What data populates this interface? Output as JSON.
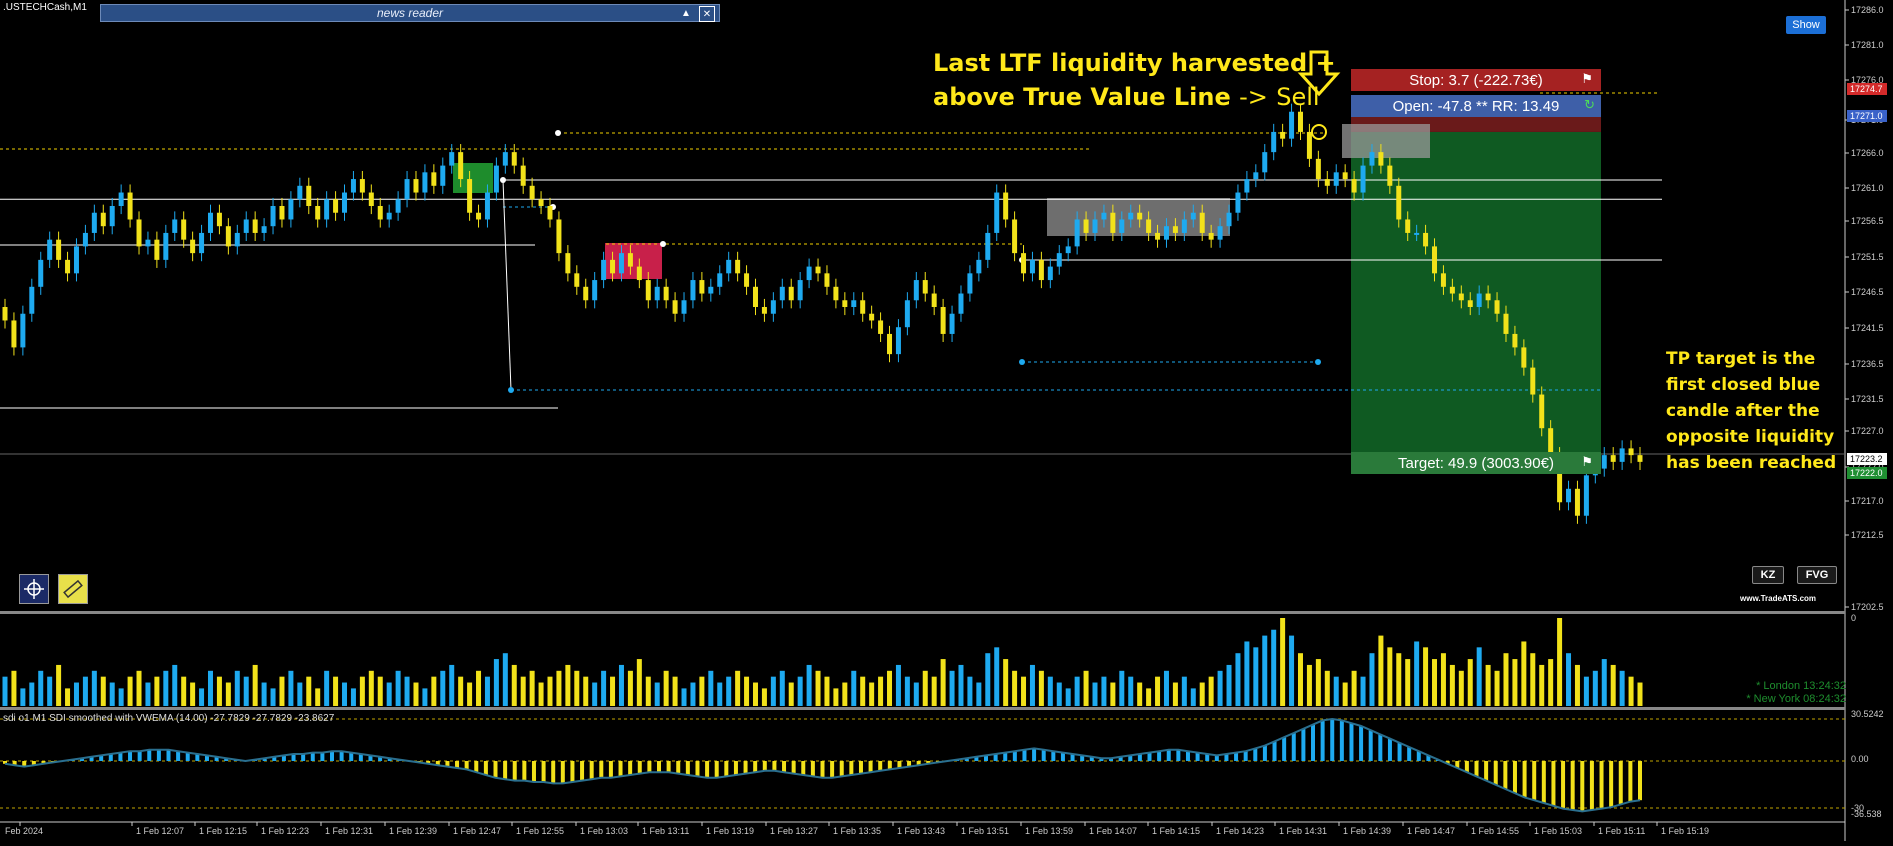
{
  "window": {
    "symbol_title": ".USTECHCash,M1"
  },
  "news_reader": {
    "title": "news reader",
    "collapse_icon": "triangle-up-icon",
    "close_icon": "close-x-icon"
  },
  "show_button": {
    "label": "Show"
  },
  "tool_buttons": {
    "crosshair_icon": "crosshair-icon",
    "ruler_icon": "ruler-icon"
  },
  "indicator_buttons": {
    "kz": "KZ",
    "fvg": "FVG"
  },
  "watermark": "www.TradeATS.com",
  "annotations": {
    "main_line1": "Last LTF liquidity harvested +",
    "main_line2": "above True Value Line",
    "main_arrow": "->",
    "main_sell": "Sell",
    "tp_note": "TP target is the first closed blue candle after the opposite liquidity has been reached"
  },
  "trade": {
    "stop_label": "Stop: 3.7 (-222.73€)",
    "open_label": "Open: -47.8 ** RR: 13.49",
    "target_label": "Target: 49.9 (3003.90€)"
  },
  "price_scale": {
    "labels": [
      "17286.0",
      "17281.0",
      "17276.0",
      "17271.0",
      "17266.0",
      "17261.0",
      "17256.5",
      "17251.5",
      "17246.5",
      "17241.5",
      "17236.5",
      "17231.5",
      "17227.0",
      "17222.0",
      "17217.0",
      "17212.5",
      "17202.5"
    ],
    "tags": [
      {
        "text": "17274.7",
        "color": "#d42a2a"
      },
      {
        "text": "17271.0",
        "color": "#3a62c9"
      },
      {
        "text": "17223.2",
        "color": "#ffffff"
      },
      {
        "text": "17222.0",
        "color": "#1f8f32"
      }
    ]
  },
  "time_axis": {
    "labels": [
      "Feb 2024",
      "1 Feb 12:07",
      "1 Feb 12:15",
      "1 Feb 12:23",
      "1 Feb 12:31",
      "1 Feb 12:39",
      "1 Feb 12:47",
      "1 Feb 12:55",
      "1 Feb 13:03",
      "1 Feb 13:11",
      "1 Feb 13:19",
      "1 Feb 13:27",
      "1 Feb 13:35",
      "1 Feb 13:43",
      "1 Feb 13:51",
      "1 Feb 13:59",
      "1 Feb 14:07",
      "1 Feb 14:15",
      "1 Feb 14:23",
      "1 Feb 14:31",
      "1 Feb 14:39",
      "1 Feb 14:47",
      "1 Feb 14:55",
      "1 Feb 15:03",
      "1 Feb 15:11",
      "1 Feb 15:19"
    ]
  },
  "volume_panel": {
    "scale_top": "0"
  },
  "sessions": {
    "london": "* London   13:24:32",
    "new_york": "* New York   08:24:32"
  },
  "sdi_panel": {
    "label": "sdi o1 M1 SDI smoothed with VWEMA (14.00) -27.7829 -27.7829 -23.8627",
    "scale": [
      "30.5242",
      "0.00",
      "-30",
      "-36.538"
    ]
  },
  "chart_data": {
    "type": "candlestick",
    "symbol": ".USTECHCash",
    "timeframe": "M1",
    "ylim": [
      17200,
      17290
    ],
    "colors": {
      "bull": "#1eaaf0",
      "bear": "#f2e21a"
    },
    "candles_close": [
      17243,
      17239,
      17244,
      17248,
      17252,
      17255,
      17252,
      17250,
      17254,
      17256,
      17259,
      17257,
      17260,
      17262,
      17258,
      17254,
      17255,
      17252,
      17256,
      17258,
      17255,
      17253,
      17256,
      17259,
      17257,
      17254,
      17256,
      17258,
      17256,
      17257,
      17260,
      17258,
      17261,
      17263,
      17260,
      17258,
      17261,
      17259,
      17262,
      17264,
      17262,
      17260,
      17258,
      17259,
      17261,
      17264,
      17262,
      17265,
      17263,
      17266,
      17268,
      17264,
      17259,
      17258,
      17262,
      17266,
      17268,
      17266,
      17263,
      17261,
      17260,
      17258,
      17253,
      17250,
      17248,
      17246,
      17249,
      17252,
      17250,
      17253,
      17251,
      17249,
      17246,
      17248,
      17246,
      17244,
      17246,
      17249,
      17247,
      17248,
      17250,
      17252,
      17250,
      17248,
      17245,
      17244,
      17246,
      17248,
      17246,
      17249,
      17251,
      17250,
      17248,
      17246,
      17245,
      17246,
      17244,
      17243,
      17241,
      17238,
      17242,
      17246,
      17249,
      17247,
      17245,
      17241,
      17244,
      17247,
      17250,
      17252,
      17256,
      17262,
      17258,
      17253,
      17250,
      17252,
      17249,
      17251,
      17253,
      17254,
      17258,
      17256,
      17258,
      17259,
      17256,
      17258,
      17259,
      17258,
      17256,
      17255,
      17257,
      17256,
      17258,
      17259,
      17256,
      17255,
      17257,
      17259,
      17262,
      17264,
      17265,
      17268,
      17271,
      17270,
      17274,
      17271,
      17267,
      17264,
      17263,
      17265,
      17264,
      17262,
      17266,
      17268,
      17266,
      17263,
      17258,
      17256,
      17256,
      17254,
      17250,
      17248,
      17247,
      17246,
      17245,
      17247,
      17246,
      17244,
      17241,
      17239,
      17236,
      17232,
      17227,
      17223,
      17216,
      17218,
      17214,
      17220,
      17221,
      17223,
      17222,
      17224,
      17223,
      17222
    ],
    "current_price": 17223.2,
    "levels": {
      "stop": 17274.7,
      "entry": 17271.0,
      "target": 17222.0,
      "true_value_line": 17261.0,
      "level_17251": 17251.5,
      "level_17254": 17254.0,
      "level_17230": 17230.5,
      "liquidity_17268": 17268.0,
      "liquidity_17254": 17254.0,
      "liquidity_17236": 17236.5,
      "liquidity_17231": 17231.5
    },
    "volume": [
      5,
      6,
      3,
      4,
      6,
      5,
      7,
      3,
      4,
      5,
      6,
      5,
      4,
      3,
      5,
      6,
      4,
      5,
      6,
      7,
      5,
      4,
      3,
      6,
      5,
      4,
      6,
      5,
      7,
      4,
      3,
      5,
      6,
      4,
      5,
      3,
      6,
      5,
      4,
      3,
      5,
      6,
      5,
      4,
      6,
      5,
      4,
      3,
      5,
      6,
      7,
      5,
      4,
      6,
      5,
      8,
      9,
      7,
      5,
      6,
      4,
      5,
      6,
      7,
      6,
      5,
      4,
      6,
      5,
      7,
      6,
      8,
      5,
      4,
      6,
      5,
      3,
      4,
      5,
      6,
      4,
      5,
      6,
      5,
      4,
      3,
      5,
      6,
      4,
      5,
      7,
      6,
      5,
      3,
      4,
      6,
      5,
      4,
      5,
      6,
      7,
      5,
      4,
      6,
      5,
      8,
      6,
      7,
      5,
      4,
      9,
      10,
      8,
      6,
      5,
      7,
      6,
      5,
      4,
      3,
      5,
      6,
      4,
      5,
      4,
      6,
      5,
      4,
      3,
      5,
      6,
      4,
      5,
      3,
      4,
      5,
      6,
      7,
      9,
      11,
      10,
      12,
      13,
      15,
      12,
      9,
      7,
      8,
      6,
      5,
      4,
      6,
      5,
      9,
      12,
      10,
      9,
      8,
      11,
      10,
      8,
      9,
      7,
      6,
      8,
      10,
      7,
      6,
      9,
      8,
      11,
      9,
      7,
      8,
      15,
      9,
      7,
      5,
      6,
      8,
      7,
      6,
      5,
      4
    ],
    "sdi": [
      -2,
      -3,
      -4,
      -3,
      -2,
      -1,
      0,
      1,
      2,
      3,
      4,
      5,
      6,
      7,
      7,
      8,
      8,
      8,
      7,
      6,
      5,
      4,
      3,
      2,
      1,
      0,
      1,
      2,
      3,
      4,
      5,
      5,
      6,
      6,
      7,
      7,
      6,
      5,
      4,
      3,
      2,
      1,
      0,
      -1,
      -2,
      -3,
      -4,
      -5,
      -6,
      -8,
      -10,
      -12,
      -13,
      -14,
      -14,
      -15,
      -15,
      -16,
      -16,
      -15,
      -14,
      -13,
      -12,
      -12,
      -11,
      -10,
      -9,
      -8,
      -8,
      -8,
      -9,
      -10,
      -11,
      -12,
      -12,
      -11,
      -10,
      -9,
      -8,
      -7,
      -7,
      -8,
      -9,
      -10,
      -11,
      -12,
      -12,
      -11,
      -10,
      -9,
      -8,
      -7,
      -6,
      -5,
      -4,
      -3,
      -2,
      -1,
      0,
      1,
      2,
      3,
      4,
      5,
      6,
      7,
      8,
      9,
      8,
      7,
      6,
      5,
      4,
      3,
      2,
      2,
      3,
      4,
      5,
      6,
      7,
      8,
      8,
      7,
      6,
      5,
      4,
      5,
      6,
      7,
      9,
      11,
      14,
      17,
      20,
      23,
      26,
      29,
      30,
      29,
      27,
      25,
      22,
      19,
      16,
      13,
      10,
      7,
      4,
      1,
      -2,
      -5,
      -8,
      -11,
      -14,
      -17,
      -20,
      -23,
      -26,
      -28,
      -30,
      -32,
      -34,
      -35,
      -36,
      -35,
      -34,
      -33,
      -31,
      -29,
      -28
    ]
  }
}
